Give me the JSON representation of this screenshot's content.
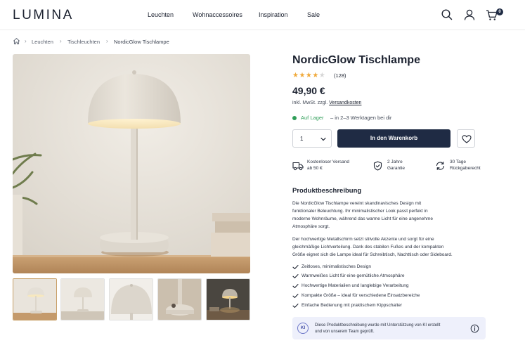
{
  "header": {
    "logo": "LUMINA",
    "nav": [
      "Leuchten",
      "Wohnaccessoires",
      "Inspiration",
      "Sale"
    ],
    "cart_count": "0"
  },
  "breadcrumb": {
    "items": [
      "Leuchten",
      "Tischleuchten",
      "NordicGlow Tischlampe"
    ]
  },
  "product": {
    "title": "NordicGlow Tischlampe",
    "rating": 4,
    "rating_max": 5,
    "review_count": "(128)",
    "price": "49,90 €",
    "tax_note": "inkl. MwSt. zzgl.",
    "shipping_link": "Versandkosten",
    "stock_label": "Auf Lager",
    "stock_delivery": "– in 2–3 Werktagen bei dir",
    "quantity": "1",
    "add_to_cart": "In den Warenkorb"
  },
  "features": [
    {
      "icon": "truck-icon",
      "line1": "Kostenloser Versand",
      "line2": "ab 50 €"
    },
    {
      "icon": "shield-check-icon",
      "line1": "2 Jahre",
      "line2": "Garantie"
    },
    {
      "icon": "return-arrows-icon",
      "line1": "30 Tage",
      "line2": "Rückgaberecht"
    }
  ],
  "description": {
    "title": "Produktbeschreibung",
    "p1": [
      "Die NordicGlow Tischlampe vereint skandinavisches Design mit",
      "funktionaler Beleuchtung. Ihr minimalistischer Look passt perfekt in",
      "moderne Wohnräume, während das warme Licht für eine angenehme",
      "Atmosphäre sorgt."
    ],
    "p2": [
      "Der hochwertige Metallschirm setzt stilvolle Akzente und sorgt für eine",
      "gleichmäßige Lichtverteilung. Dank des stabilen Fußes und der kompakten",
      "Größe eignet sich die Lampe ideal für Schreibtisch, Nachttisch oder Sideboard."
    ],
    "bullets": [
      "Zeitloses, minimalistisches Design",
      "Warmweißes Licht für eine gemütliche Atmosphäre",
      "Hochwertige Materialien und langlebige Verarbeitung",
      "Kompakte Größe – ideal für verschiedene Einsatzbereiche",
      "Einfache Bedienung mit praktischem Kippschalter"
    ]
  },
  "ai_notice": {
    "badge": "KI",
    "line1": "Diese Produktbeschreibung wurde mit Unterstützung von KI erstellt",
    "line2": "und von unserem Team geprüft."
  },
  "colors": {
    "primary": "#1f2b44",
    "star": "#f0a93a",
    "stock": "#2f9e58",
    "ai_bg": "#eef0fb"
  }
}
